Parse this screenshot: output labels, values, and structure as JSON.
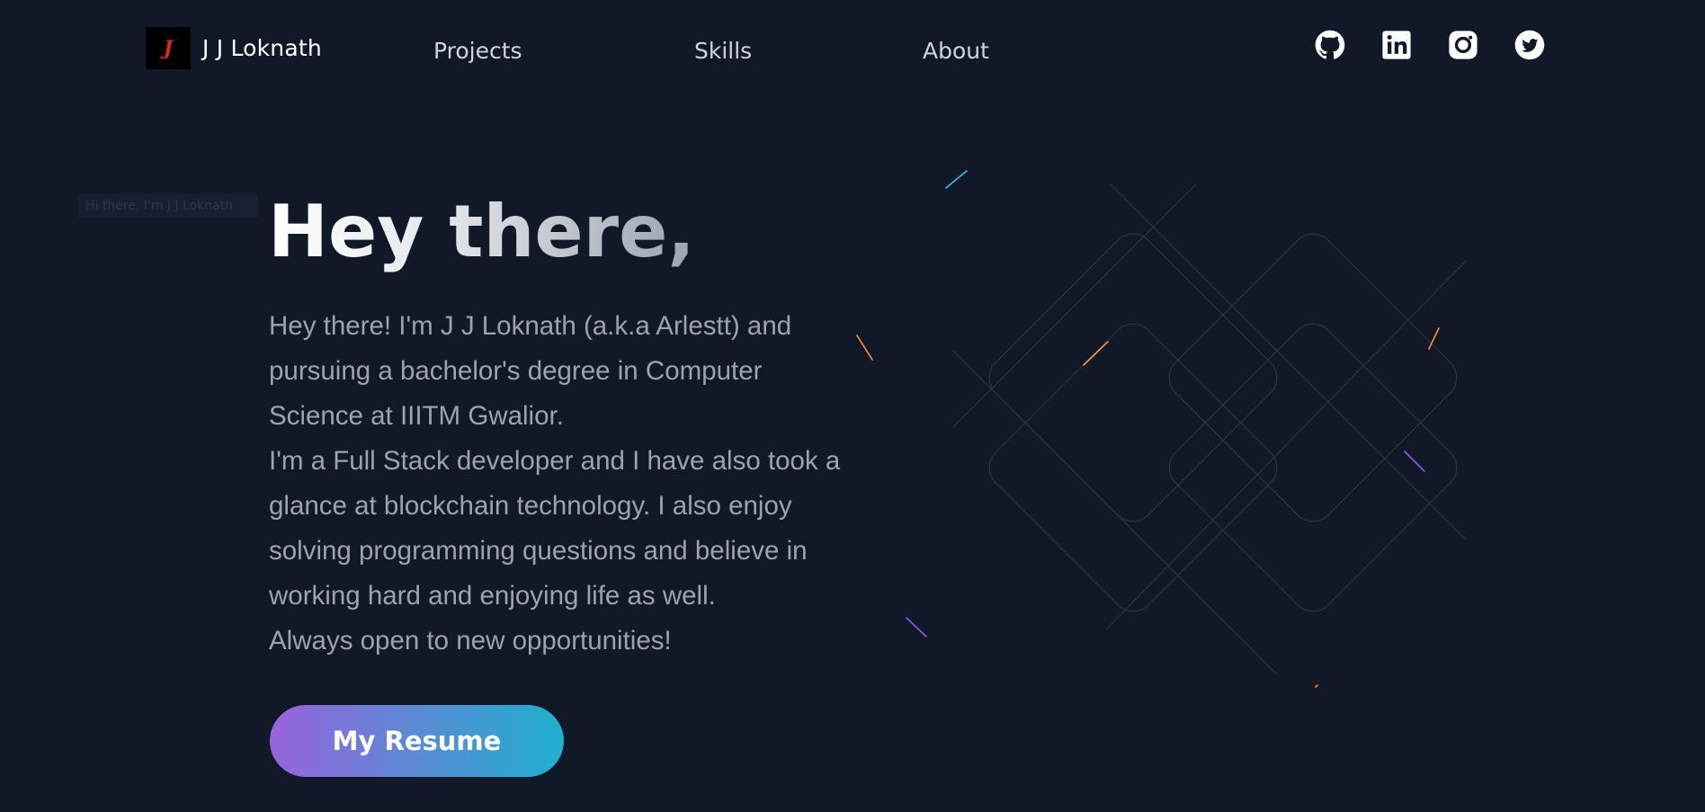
{
  "header": {
    "logo_glyph": "J",
    "brand_name": "J J Loknath",
    "nav": [
      {
        "label": "Projects"
      },
      {
        "label": "Skills"
      },
      {
        "label": "About"
      }
    ],
    "social": [
      {
        "icon": "github-icon"
      },
      {
        "icon": "linkedin-icon"
      },
      {
        "icon": "instagram-icon"
      },
      {
        "icon": "twitter-icon"
      }
    ]
  },
  "bg_label": "Hi there, I'm J J Loknath",
  "hero": {
    "title": "Hey there,",
    "bio_lines": [
      "Hey there! I'm J J Loknath (a.k.a Arlestt) and",
      "pursuing a bachelor's degree in Computer",
      "Science at IIITM Gwalior.",
      "I'm a Full Stack developer and I have also took a",
      "glance at blockchain technology. I also enjoy",
      "solving programming questions and believe in",
      "working hard and enjoying life as well.",
      "Always open to new opportunities!"
    ],
    "resume_label": "My Resume"
  },
  "colors": {
    "background": "#111827",
    "button_gradient_start": "#9a63dd",
    "button_gradient_end": "#1fb0ce",
    "logo_accent": "#dc2626"
  }
}
